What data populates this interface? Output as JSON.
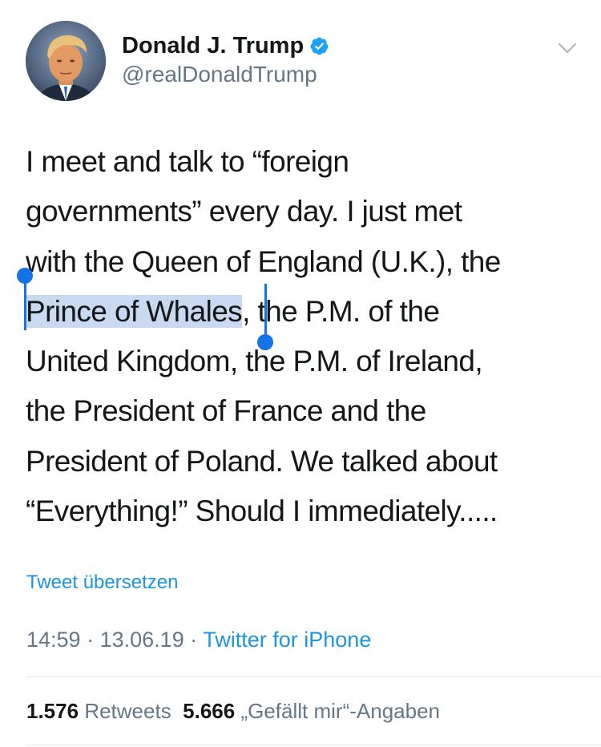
{
  "author": {
    "name": "Donald J. Trump",
    "handle": "@realDonaldTrump",
    "verified": true,
    "avatar": "profile-photo"
  },
  "tweet": {
    "lines": [
      "I meet and talk to “foreign",
      "governments” every day. I just met",
      "with the Queen of England (U.K.), the",
      ", the P.M. of the",
      "United Kingdom, the P.M. of Ireland,",
      "the President of France and the",
      "President of Poland. We talked about",
      "“Everything!” Should I immediately....."
    ],
    "selected_text": "Prince of Whales"
  },
  "translate_link": "Tweet übersetzen",
  "meta": {
    "time": "14:59",
    "separator": "·",
    "date": "13.06.19",
    "source": "Twitter for iPhone"
  },
  "stats": {
    "retweets_count": "1.576",
    "retweets_label": "Retweets",
    "likes_count": "5.666",
    "likes_label": "„Gefällt mir“-Angaben"
  },
  "colors": {
    "link": "#1b95e0",
    "verified": "#1da1f2",
    "selection": "#c9daf0",
    "selection_handle": "#1473e6",
    "secondary_text": "#657786"
  },
  "icons": {
    "verified": "verified-badge-icon",
    "more": "chevron-down-icon"
  }
}
